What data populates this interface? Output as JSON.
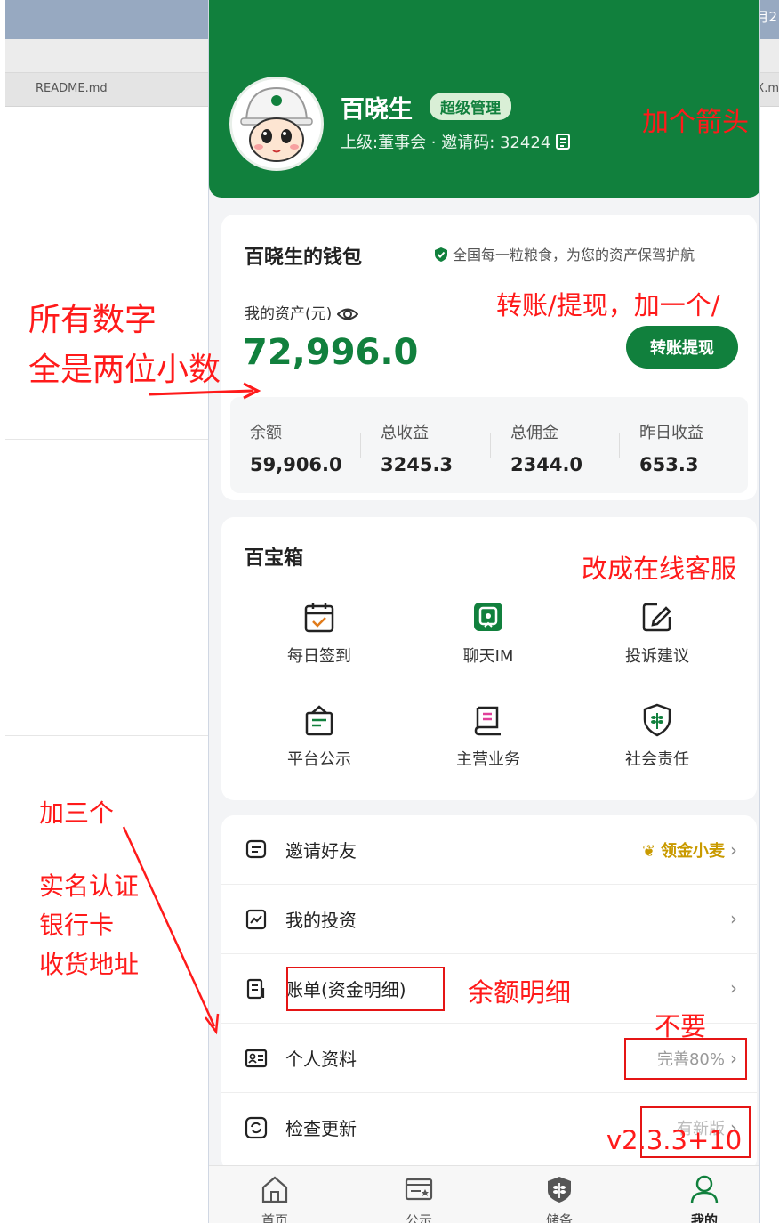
{
  "background": {
    "left_tab": "README.md",
    "right_tab": "X.m",
    "corner_text": "月2"
  },
  "profile": {
    "name": "百晓生",
    "badge": "超级管理",
    "subtitle": "上级:董事会 · 邀请码: 32424"
  },
  "wallet": {
    "title": "百晓生的钱包",
    "slogan": "全国每一粒粮食，为您的资产保驾护航",
    "assets_label": "我的资产(元)",
    "assets_value": "72,996.0",
    "transfer_button": "转账提现",
    "stats": [
      {
        "label": "余额",
        "value": "59,906.0"
      },
      {
        "label": "总收益",
        "value": "3245.3"
      },
      {
        "label": "总佣金",
        "value": "2344.0"
      },
      {
        "label": "昨日收益",
        "value": "653.3"
      }
    ]
  },
  "toolbox": {
    "title": "百宝箱",
    "items": [
      {
        "label": "每日签到",
        "icon": "calendar-check-icon"
      },
      {
        "label": "聊天IM",
        "icon": "chat-im-icon"
      },
      {
        "label": "投诉建议",
        "icon": "edit-icon"
      },
      {
        "label": "平台公示",
        "icon": "notice-icon"
      },
      {
        "label": "主营业务",
        "icon": "book-icon"
      },
      {
        "label": "社会责任",
        "icon": "wheat-shield-icon"
      }
    ]
  },
  "menu": {
    "items": [
      {
        "label": "邀请好友",
        "right": "领金小麦",
        "icon": "invite-icon"
      },
      {
        "label": "我的投资",
        "right": "",
        "icon": "chart-icon"
      },
      {
        "label": "账单(资金明细)",
        "right": "",
        "icon": "bill-icon"
      },
      {
        "label": "个人资料",
        "right": "完善80%",
        "icon": "id-card-icon"
      },
      {
        "label": "检查更新",
        "right": "有新版",
        "icon": "refresh-icon"
      }
    ]
  },
  "tabbar": {
    "items": [
      {
        "label": "首页",
        "icon": "home-icon"
      },
      {
        "label": "公示",
        "icon": "notice-board-icon"
      },
      {
        "label": "储备",
        "icon": "grain-icon"
      },
      {
        "label": "我的",
        "icon": "user-icon"
      }
    ]
  },
  "annotations": {
    "arrow_note": "加个箭头",
    "decimals_line1": "所有数字",
    "decimals_line2": "全是两位小数",
    "transfer_note": "转账/提现，加一个/",
    "service_note": "改成在线客服",
    "add_three": "加三个",
    "item1": "实名认证",
    "item2": "银行卡",
    "item3": "收货地址",
    "balance_note": "余额明细",
    "no_need": "不要",
    "version": "v2.3.3+10"
  },
  "colors": {
    "brand_green": "#11803d",
    "annotation_red": "#ff1a1a",
    "gold": "#c99a00"
  }
}
